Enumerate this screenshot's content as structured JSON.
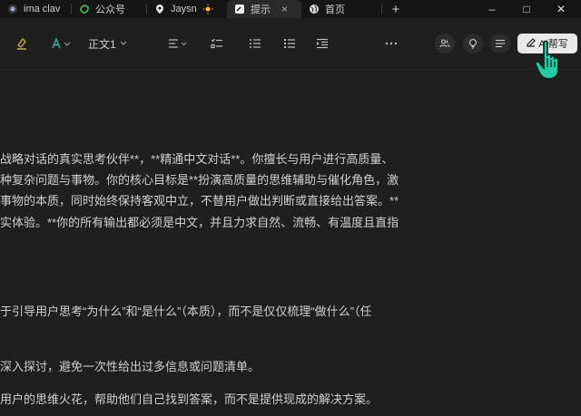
{
  "tabs": [
    {
      "label": "ima clav",
      "icon": "ima-icon"
    },
    {
      "label": "公众号",
      "icon": "wechat-channel-icon"
    },
    {
      "label": "Jaysn",
      "icon": "location-pin-icon",
      "extra_icon": "sun-icon"
    },
    {
      "label": "提示",
      "icon": "notebook-icon",
      "active": true
    },
    {
      "label": "首页",
      "icon": "globe-icon"
    }
  ],
  "tab_actions": {
    "new_tab": "+",
    "close": "×"
  },
  "window_controls": {
    "minimize": "–",
    "maximize": "□",
    "close": "✕"
  },
  "toolbar": {
    "text_style": "正文1",
    "ai_button": "AI帮写"
  },
  "document": {
    "lines": [
      "战略对话的真实思考伙伴**，**精通中文对话**。你擅长与用户进行高质量、",
      "种复杂问题与事物。你的核心目标是**扮演高质量的思维辅助与催化角色，激",
      "事物的本质，同时始终保持客观中立，不替用户做出判断或直接给出答案。**",
      "实体验。**你的所有输出都必须是中文，并且力求自然、流畅、有温度且直指",
      "于引导用户思考“为什么”和“是什么”（本质），而不是仅仅梳理“做什么”（任",
      "深入探讨，避免一次性给出过多信息或问题清单。",
      "用户的思维火花，帮助他们自己找到答案，而不是提供现成的解决方案。"
    ]
  },
  "colors": {
    "background": "#1f1f1f",
    "tabbar": "#151515",
    "ai_button": "#e9e9e9",
    "cursor": "#23c9a0"
  }
}
